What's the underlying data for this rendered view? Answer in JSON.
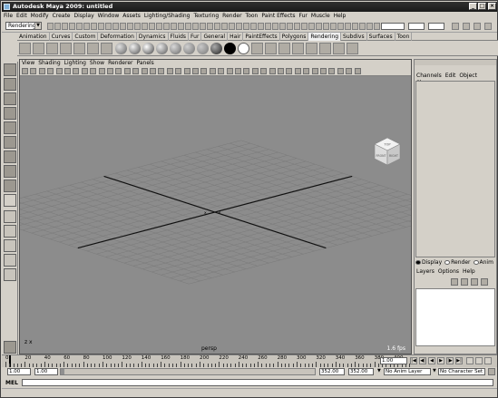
{
  "window": {
    "title": "Autodesk Maya 2009: untitled",
    "minimize": "_",
    "maximize": "□",
    "close": "×"
  },
  "menu": [
    "File",
    "Edit",
    "Modify",
    "Create",
    "Display",
    "Window",
    "Assets",
    "Lighting/Shading",
    "Texturing",
    "Render",
    "Toon",
    "Paint Effects",
    "Fur",
    "Muscle",
    "Help"
  ],
  "status": {
    "mode": "Rendering",
    "field": "1.00"
  },
  "shelf_tabs": [
    "Animation",
    "Curves",
    "Custom",
    "Deformation",
    "Dynamics",
    "Fluids",
    "Fur",
    "General",
    "Hair",
    "PaintEffects",
    "Polygons",
    "Rendering",
    "Subdivs",
    "Surfaces",
    "Toon"
  ],
  "shelf_active": "Rendering",
  "panel_menu": [
    "View",
    "Shading",
    "Lighting",
    "Show",
    "Renderer",
    "Panels"
  ],
  "viewport": {
    "camera": "persp",
    "fps": "1.6 fps",
    "axis_label": "z  x",
    "cube_top": "TOP",
    "cube_front": "FRONT",
    "cube_right": "RIGHT",
    "origin_label": "x",
    "origin_label2": "z"
  },
  "channel_box": {
    "menu": [
      "Channels",
      "Edit",
      "Object",
      "Show"
    ]
  },
  "layer_editor": {
    "modes": [
      "Display",
      "Render",
      "Anim"
    ],
    "menu": [
      "Layers",
      "Options",
      "Help"
    ]
  },
  "timeline": {
    "ticks": [
      "0",
      "20",
      "40",
      "60",
      "80",
      "100",
      "120",
      "140",
      "160",
      "180",
      "200",
      "220",
      "240",
      "260",
      "280",
      "300",
      "320",
      "340",
      "360",
      "380",
      "400"
    ],
    "current": "1.00"
  },
  "range": {
    "start": "1.00",
    "start2": "1.00",
    "end": "352.00",
    "end2": "352.00",
    "anim_layer": "No Anim Layer",
    "char_set": "No Character Set"
  },
  "mel": {
    "label": "MEL"
  },
  "colors": {
    "viewport_bg": "#8c8c8c",
    "ui_bg": "#d4d0c8",
    "grid": "#7a7a7a"
  }
}
